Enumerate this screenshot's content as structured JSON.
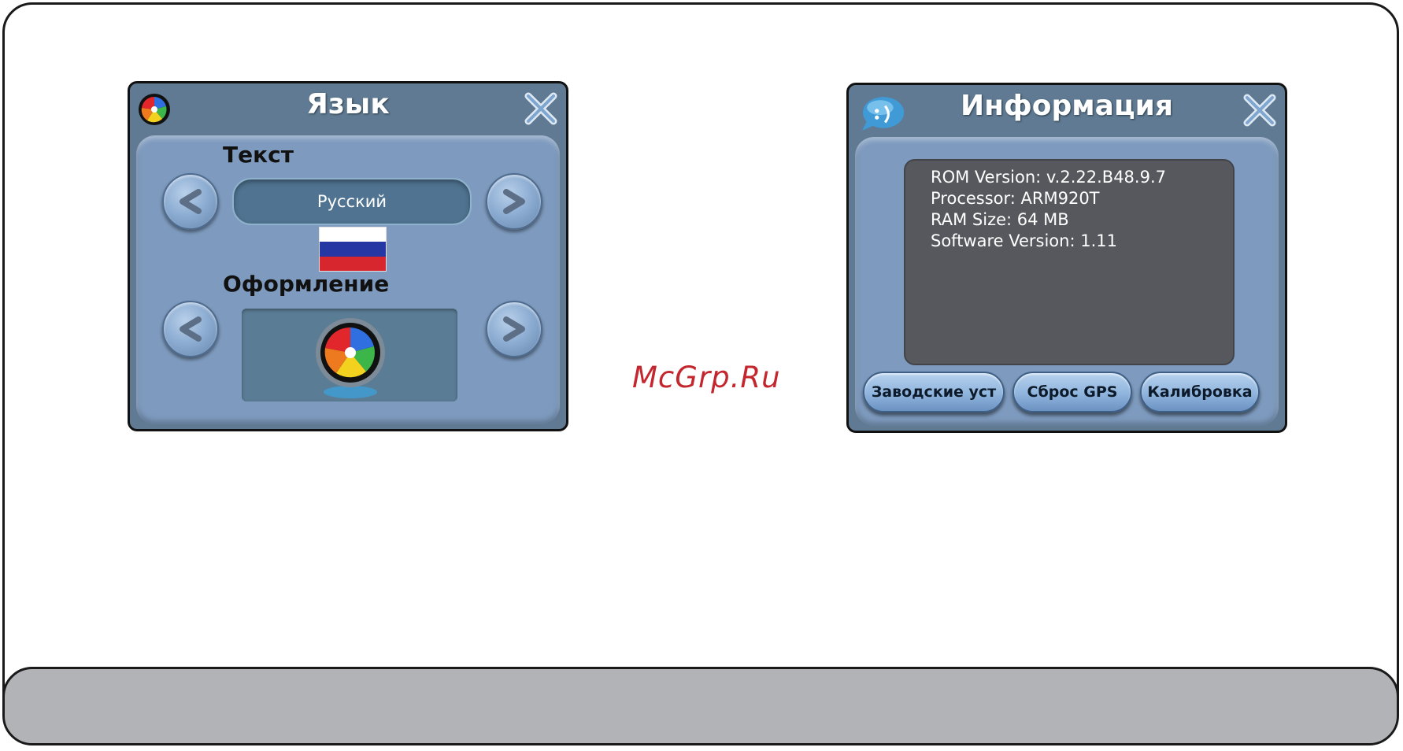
{
  "language_dialog": {
    "title": "Язык",
    "text_section_label": "Текст",
    "language_value": "Русский",
    "theme_section_label": "Оформление"
  },
  "info_dialog": {
    "title": "Информация",
    "info_lines": [
      "ROM Version: v.2.22.B48.9.7",
      "Processor: ARM920T",
      "RAM Size: 64 MB",
      "Software Version: 1.11"
    ],
    "buttons": {
      "factory_reset": "Заводские уст",
      "reset_gps": "Сброс GPS",
      "calibration": "Калибровка"
    }
  },
  "watermark": "McGrp.Ru",
  "colors": {
    "dialog_frame": "#5f7a92",
    "dialog_body": "#7e9bbf",
    "info_screen": "#56585d",
    "watermark": "#c4262e",
    "footer_bar": "#b1b3b6"
  },
  "icons": {
    "language_app": "color-wheel-icon",
    "info_app": "chat-bubble-icon",
    "close": "close-x-icon",
    "prev": "chevron-left-icon",
    "next": "chevron-right-icon",
    "flag": "russian-flag-icon",
    "theme": "color-wheel-icon"
  }
}
